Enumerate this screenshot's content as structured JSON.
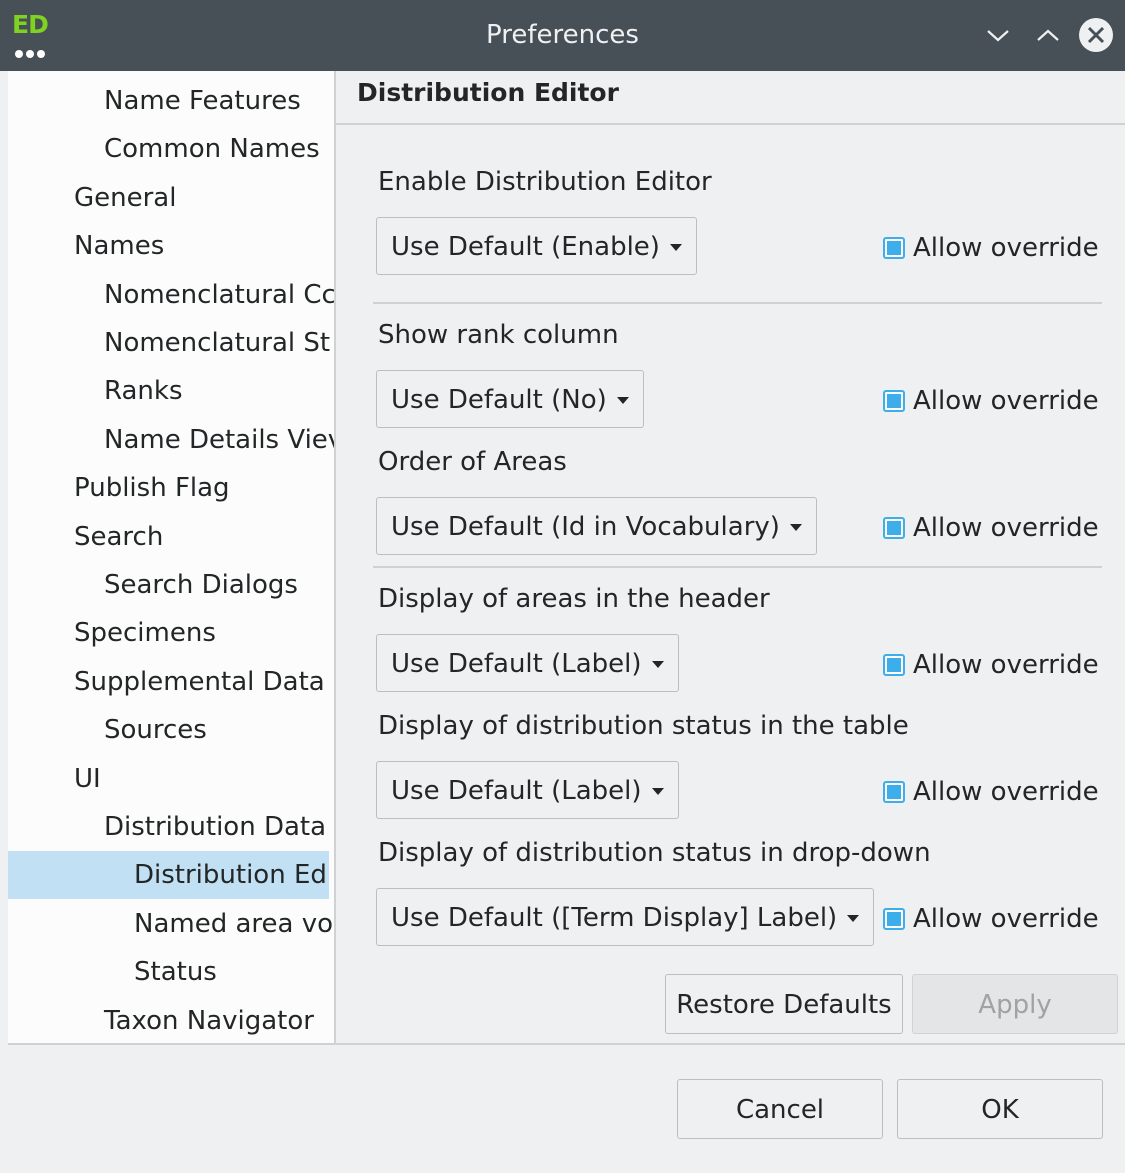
{
  "window": {
    "title": "Preferences",
    "app_icon_text": "ED"
  },
  "sidebar": {
    "items": [
      {
        "label": "Name Features",
        "level": 2
      },
      {
        "label": "Common Names",
        "level": 2
      },
      {
        "label": "General",
        "level": 1
      },
      {
        "label": "Names",
        "level": 1
      },
      {
        "label": "Nomenclatural Cc",
        "level": 2
      },
      {
        "label": "Nomenclatural St",
        "level": 2
      },
      {
        "label": "Ranks",
        "level": 2
      },
      {
        "label": "Name Details Viev",
        "level": 2
      },
      {
        "label": "Publish Flag",
        "level": 1
      },
      {
        "label": "Search",
        "level": 1
      },
      {
        "label": "Search Dialogs",
        "level": 2
      },
      {
        "label": "Specimens",
        "level": 1
      },
      {
        "label": "Supplemental Data",
        "level": 1
      },
      {
        "label": "Sources",
        "level": 2
      },
      {
        "label": "UI",
        "level": 1
      },
      {
        "label": "Distribution Data",
        "level": 2
      },
      {
        "label": "Distribution Edi",
        "level": 3,
        "selected": true
      },
      {
        "label": "Named area vo",
        "level": 3
      },
      {
        "label": "Status",
        "level": 3
      },
      {
        "label": "Taxon Navigator",
        "level": 2
      }
    ]
  },
  "page": {
    "title": "Distribution Editor",
    "settings": [
      {
        "label": "Enable Distribution Editor",
        "value": "Use Default (Enable)",
        "override_label": "Allow override",
        "override_checked": true
      },
      {
        "label": "Show rank column",
        "value": "Use Default (No)",
        "override_label": "Allow override",
        "override_checked": true
      },
      {
        "label": "Order of Areas",
        "value": "Use Default (Id in Vocabulary)",
        "override_label": "Allow override",
        "override_checked": true
      },
      {
        "label": "Display of areas in the header",
        "value": "Use Default (Label)",
        "override_label": "Allow override",
        "override_checked": true
      },
      {
        "label": "Display of distribution status in the table",
        "value": "Use Default (Label)",
        "override_label": "Allow override",
        "override_checked": true
      },
      {
        "label": "Display of distribution status in drop-down",
        "value": "Use Default ([Term Display] Label)",
        "override_label": "Allow override",
        "override_checked": true
      }
    ],
    "restore_defaults_label": "Restore Defaults",
    "apply_label": "Apply"
  },
  "dialog": {
    "cancel_label": "Cancel",
    "ok_label": "OK"
  },
  "colors": {
    "titlebar": "#475057",
    "selection": "#c2e0f4",
    "accent": "#3daee9"
  }
}
